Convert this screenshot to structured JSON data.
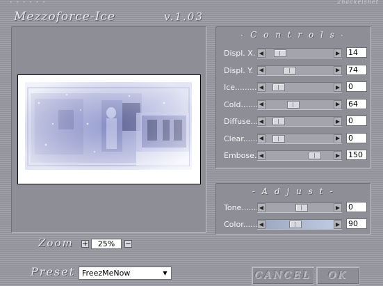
{
  "window": {
    "title": "Mezzoforce-Ice",
    "version": "v.1.03",
    "right_caption": "2nackelsnet",
    "title_dots": "• • • • • •"
  },
  "controls": {
    "heading": "- C o n t r o l s -",
    "items": [
      {
        "label": "Displ. X.",
        "value": "14",
        "position": 0.15
      },
      {
        "label": "Displ. Y.",
        "value": "74",
        "position": 0.32
      },
      {
        "label": "Ice.........",
        "value": "0",
        "position": 0.12
      },
      {
        "label": "Cold.......",
        "value": "64",
        "position": 0.38
      },
      {
        "label": "Diffuse....",
        "value": "0",
        "position": 0.12
      },
      {
        "label": "Clear.......",
        "value": "0",
        "position": 0.12
      },
      {
        "label": "Embose.",
        "value": "150",
        "position": 0.75
      }
    ]
  },
  "adjust": {
    "heading": "- A d j u s t -",
    "items": [
      {
        "label": "Tone.......",
        "value": "0",
        "position": 0.52
      },
      {
        "label": "Color.......",
        "value": "90",
        "position": 0.41
      }
    ]
  },
  "zoom": {
    "label": "Zoom",
    "value": "25%",
    "plus": "+",
    "minus": "−"
  },
  "preset": {
    "label": "Preset",
    "selected": "FreezMeNow"
  },
  "buttons": {
    "cancel": "CANCEL",
    "ok": "OK"
  }
}
